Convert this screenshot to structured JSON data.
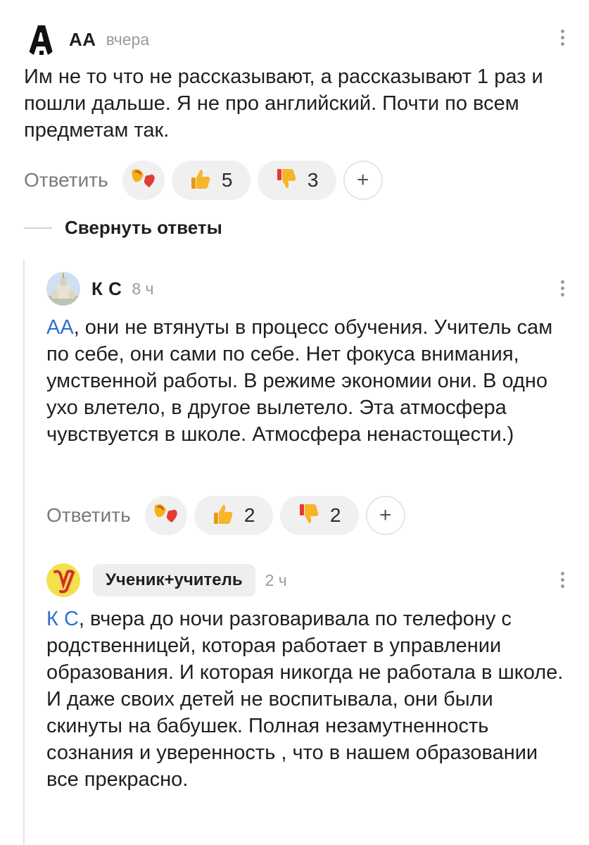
{
  "comments": [
    {
      "author": "АА",
      "time": "вчера",
      "avatar_letter": "А",
      "text": "Им не то что не рассказывают, а рассказывают 1 раз и пошли дальше. Я не про английский. Почти по всем предметам так.",
      "reply_label": "Ответить",
      "likes": "5",
      "dislikes": "3",
      "add_label": "+"
    },
    {
      "author": "К С",
      "time": "8 ч",
      "mention": "АА",
      "text": ", они не втянуты в процесс обучения. Учитель сам по себе, они сами по себе. Нет фокуса внимания, умственной работы. В режиме экономии они. В одно ухо влетело, в другое вылетело. Эта атмосфера чувствуется в школе. Атмосфера ненастощести.)",
      "reply_label": "Ответить",
      "likes": "2",
      "dislikes": "2",
      "add_label": "+"
    },
    {
      "author": "Ученик+учитель",
      "time": "2 ч",
      "mention": "К С",
      "text": ", вчера до ночи разговаривала по телефону с родственницей, которая работает в управлении образования. И которая никогда не работала в школе. И даже своих детей не воспитывала, они были скинуты на бабушек. Полная незамутненность сознания и уверенность , что в нашем образовании все прекрасно."
    }
  ],
  "collapse_label": "Свернуть ответы",
  "icons": {
    "reaction_emoji": "heart-emoji-icon",
    "like": "thumbs-up-icon",
    "dislike": "thumbs-down-icon",
    "more": "kebab-menu-icon"
  },
  "colors": {
    "mention": "#2f6fd6",
    "muted": "#9a9a9a",
    "chip": "#eeeeee"
  }
}
